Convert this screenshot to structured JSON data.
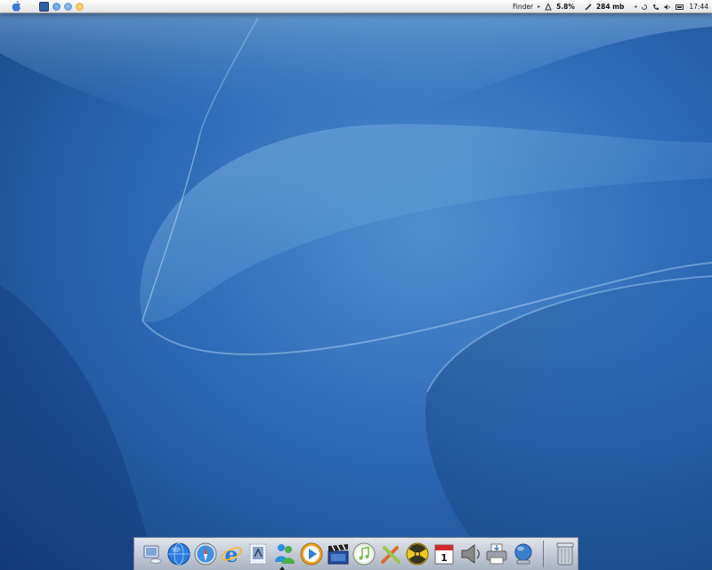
{
  "menubar": {
    "app_name": "Finder",
    "cpu_usage": "5.8%",
    "memory": "284 mb",
    "clock": "17:44",
    "quick_launch": [
      {
        "name": "show-desktop-icon",
        "color": "#2e5fa8"
      },
      {
        "name": "explorer-icon",
        "color": "#3b7bd3"
      },
      {
        "name": "network-icon",
        "color": "#4c8ad6"
      },
      {
        "name": "messenger-icon",
        "color": "#e2a81e"
      }
    ]
  },
  "dock": {
    "items": [
      {
        "name": "my-computer-icon",
        "color": "#7fa6d8"
      },
      {
        "name": "network-globe-icon",
        "color": "#2a7de0"
      },
      {
        "name": "safari-compass-icon",
        "color": "#3c92e8"
      },
      {
        "name": "internet-explorer-icon",
        "color": "#2d77d8"
      },
      {
        "name": "mail-stamp-icon",
        "color": "#8aa5c8"
      },
      {
        "name": "msn-messenger-icon",
        "color": "#4bb043"
      },
      {
        "name": "media-player-icon",
        "color": "#f0a020"
      },
      {
        "name": "movie-clapper-icon",
        "color": "#2450a0"
      },
      {
        "name": "itunes-icon",
        "color": "#6fbf4a"
      },
      {
        "name": "tools-icon",
        "color": "#e06a2a"
      },
      {
        "name": "nuclear-burner-icon",
        "color": "#f0c818"
      },
      {
        "name": "calendar-icon",
        "color": "#d42a2a"
      },
      {
        "name": "speaker-icon",
        "color": "#777777"
      },
      {
        "name": "printer-icon",
        "color": "#9aa2ad"
      },
      {
        "name": "sherlock-icon",
        "color": "#3a7fcf"
      }
    ],
    "calendar_day": "1",
    "trash": {
      "name": "trash-icon",
      "color": "#b8bec8"
    }
  }
}
